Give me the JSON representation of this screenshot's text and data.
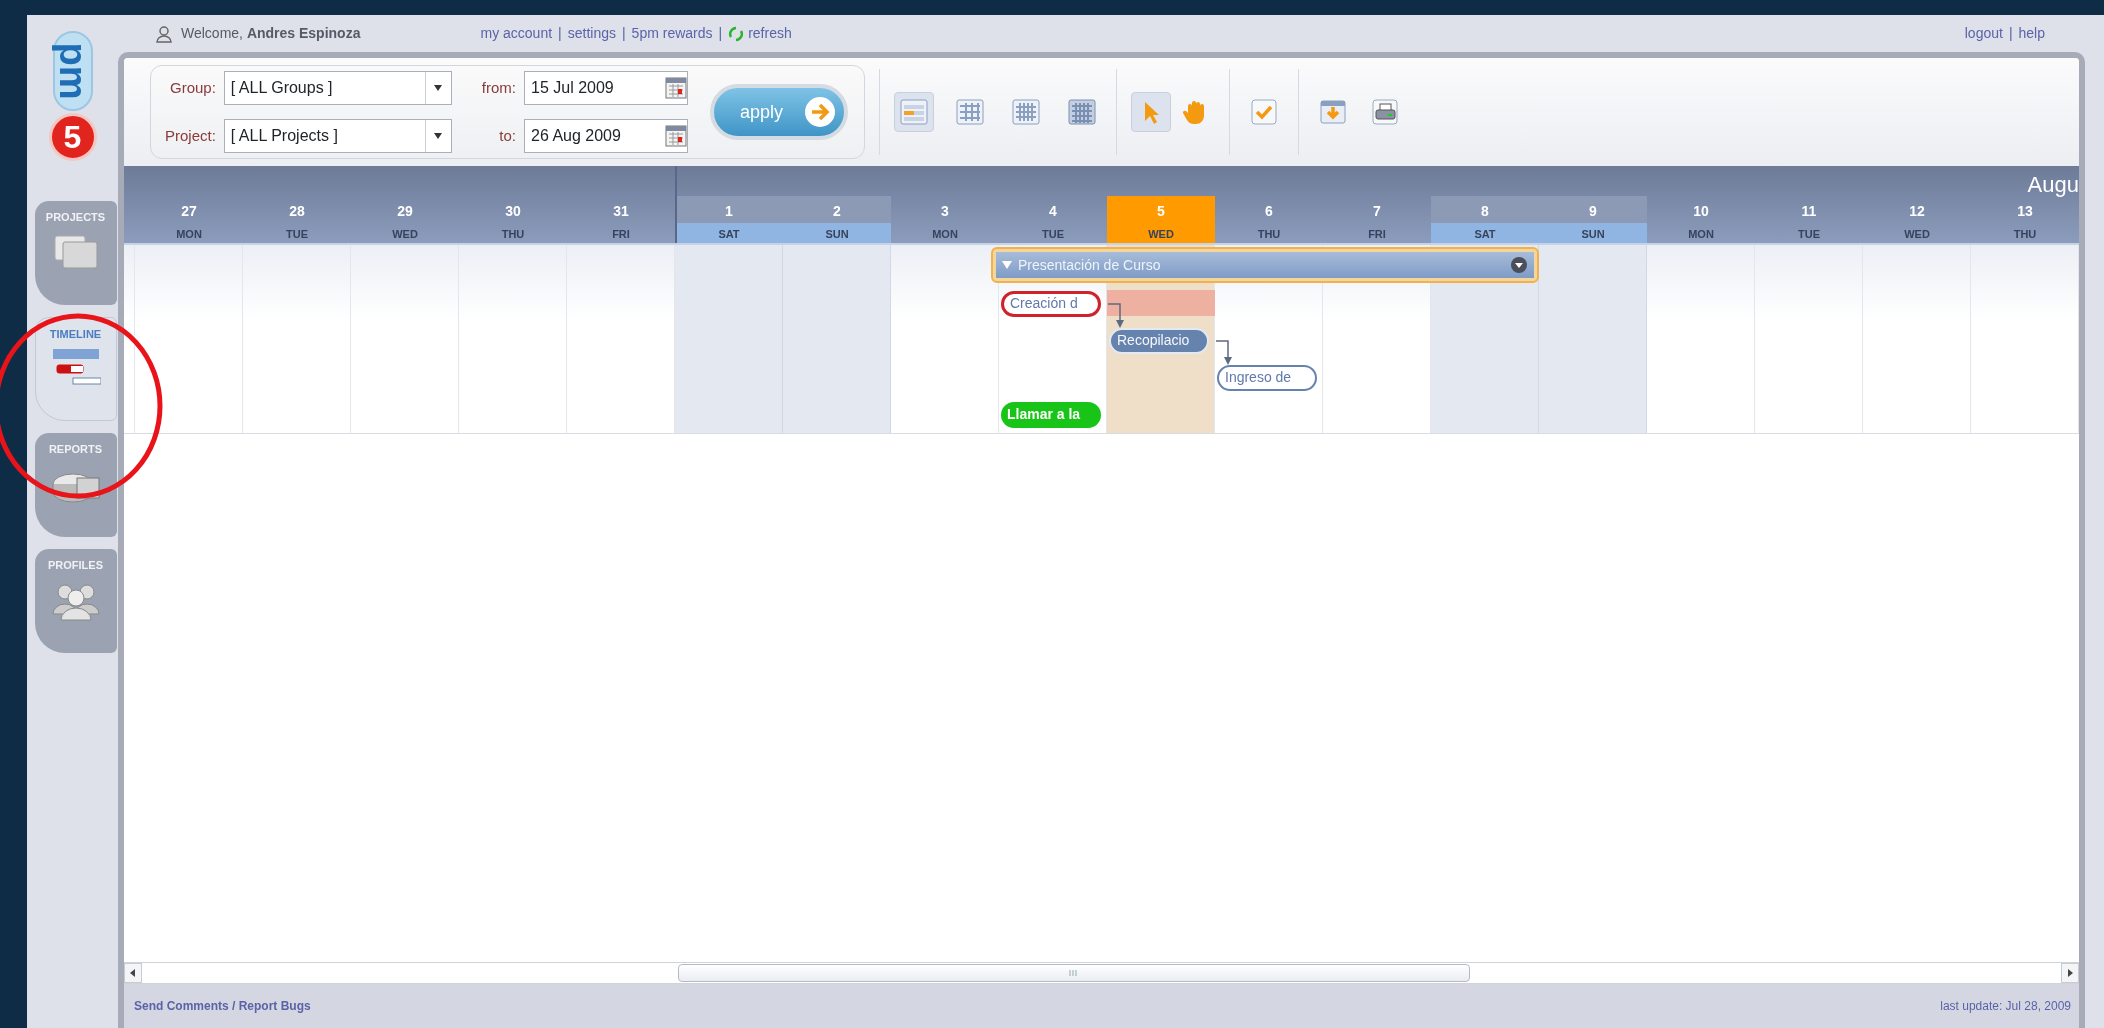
{
  "header": {
    "welcome": "Welcome,",
    "user_name": "Andres Espinoza",
    "separator": "|",
    "links": [
      {
        "label": "my account",
        "kind": "link"
      },
      {
        "label": "settings",
        "kind": "link"
      },
      {
        "label": "5pm rewards",
        "kind": "link"
      },
      {
        "label": "refresh",
        "kind": "refresh"
      }
    ],
    "right_links": [
      {
        "label": "logout"
      },
      {
        "label": "help"
      }
    ]
  },
  "logo": {
    "number": "5",
    "suffix": "pm"
  },
  "sidebar": {
    "tabs": [
      {
        "label": "PROJECTS",
        "kind": "projects",
        "selected": false
      },
      {
        "label": "TIMELINE",
        "kind": "timeline",
        "selected": true
      },
      {
        "label": "REPORTS",
        "kind": "reports",
        "selected": false
      },
      {
        "label": "PROFILES",
        "kind": "profiles",
        "selected": false
      }
    ]
  },
  "annotation": {
    "kind": "circle"
  },
  "filters": {
    "group": {
      "label": "Group:",
      "value": "[ ALL Groups ]"
    },
    "project": {
      "label": "Project:",
      "value": "[ ALL Projects ]"
    },
    "from": {
      "label": "from:",
      "value": "15 Jul 2009"
    },
    "to": {
      "label": "to:",
      "value": "26 Aug 2009"
    },
    "apply": "apply"
  },
  "toolbar": {
    "views": [
      {
        "kind": "week",
        "selected": true
      },
      {
        "kind": "month",
        "selected": false
      },
      {
        "kind": "quarter",
        "selected": false
      },
      {
        "kind": "year",
        "selected": false
      }
    ],
    "modes": [
      {
        "kind": "pointer",
        "selected": true
      },
      {
        "kind": "hand",
        "selected": false
      }
    ],
    "actions": [
      {
        "kind": "check"
      },
      {
        "kind": "export"
      },
      {
        "kind": "print"
      }
    ]
  },
  "calendar": {
    "months": [
      {
        "days": [
          {
            "day": "27",
            "weekday": "MON",
            "kind": "weekday"
          },
          {
            "day": "28",
            "weekday": "TUE",
            "kind": "weekday"
          },
          {
            "day": "29",
            "weekday": "WED",
            "kind": "weekday"
          },
          {
            "day": "30",
            "weekday": "THU",
            "kind": "weekday"
          },
          {
            "day": "31",
            "weekday": "FRI",
            "kind": "weekday"
          }
        ]
      },
      {
        "label": "Augu",
        "days": [
          {
            "day": "1",
            "weekday": "SAT",
            "kind": "weekend"
          },
          {
            "day": "2",
            "weekday": "SUN",
            "kind": "weekend"
          },
          {
            "day": "3",
            "weekday": "MON",
            "kind": "weekday"
          },
          {
            "day": "4",
            "weekday": "TUE",
            "kind": "weekday",
            "tasks": [
              {
                "label": "Presentación de Curso",
                "kind": "summary"
              },
              {
                "label": "Creación d",
                "kind": "late",
                "late": true,
                "linked": true
              },
              {
                "label": "Llamar a la",
                "kind": "done",
                "late": false,
                "linked": false
              }
            ]
          },
          {
            "day": "5",
            "weekday": "WED",
            "kind": "today",
            "tasks": [
              {
                "label": "Recopilacio",
                "kind": "active",
                "late": false,
                "linked": true
              }
            ]
          },
          {
            "day": "6",
            "weekday": "THU",
            "kind": "weekday",
            "tasks": [
              {
                "label": "Ingreso de",
                "kind": "open",
                "late": false,
                "linked": false
              }
            ]
          },
          {
            "day": "7",
            "weekday": "FRI",
            "kind": "weekday"
          },
          {
            "day": "8",
            "weekday": "SAT",
            "kind": "weekend"
          },
          {
            "day": "9",
            "weekday": "SUN",
            "kind": "weekend"
          },
          {
            "day": "10",
            "weekday": "MON",
            "kind": "weekday"
          },
          {
            "day": "11",
            "weekday": "TUE",
            "kind": "weekday"
          },
          {
            "day": "12",
            "weekday": "WED",
            "kind": "weekday"
          },
          {
            "day": "13",
            "weekday": "THU",
            "kind": "weekday"
          }
        ]
      }
    ]
  },
  "footer": {
    "feedback_link": "Send Comments / Report Bugs",
    "last_update": "last update: Jul 28, 2009"
  }
}
